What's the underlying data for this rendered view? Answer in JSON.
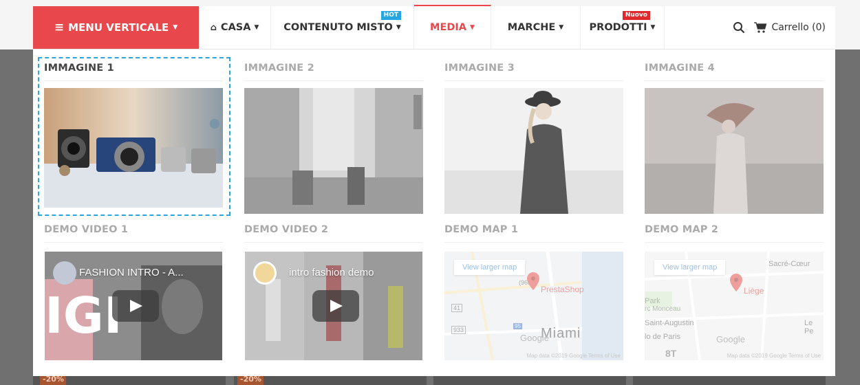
{
  "nav": {
    "vertical_menu": "MENU VERTICALE",
    "items": [
      {
        "label": "CASA"
      },
      {
        "label": "CONTENUTO MISTO",
        "badge": "HOT"
      },
      {
        "label": "MEDIA"
      },
      {
        "label": "MARCHE"
      },
      {
        "label": "PRODOTTI",
        "badge": "Nuovo"
      }
    ],
    "cart": "Carrello (0)",
    "active_color": "#e8474c",
    "vertical_menu_color": "#e8474c",
    "hot_badge_color": "#27a6e0",
    "new_badge_color": "#e0292f"
  },
  "media": {
    "images": [
      {
        "title": "IMMAGINE 1"
      },
      {
        "title": "IMMAGINE 2"
      },
      {
        "title": "IMMAGINE 3"
      },
      {
        "title": "IMMAGINE 4"
      }
    ],
    "videos": [
      {
        "title": "DEMO VIDEO 1",
        "video_title": "FASHION INTRO - A..."
      },
      {
        "title": "DEMO VIDEO 2",
        "video_title": "intro fashion demo"
      }
    ],
    "maps": [
      {
        "title": "DEMO MAP 1",
        "button": "View larger map",
        "place": "PrestaShop",
        "city": "Miami",
        "num1": "(968)",
        "num2": "41",
        "num3": "933",
        "num4": "95",
        "brand": "Google",
        "footer": "Map data ©2019 Google   Terms of Use"
      },
      {
        "title": "DEMO MAP 2",
        "button": "View larger map",
        "place": "Liège",
        "l1": "Sacré-Cœur",
        "l2": "Park",
        "l3": "rc Monceau",
        "l4": "Saint-Augustin",
        "l5": "lo de Paris",
        "l6": "Le Pe",
        "l7": "8T",
        "brand": "Google",
        "footer": "Map data ©2019 Google   Terms of Use"
      }
    ],
    "selection_color": "#2aa4dd"
  },
  "background": {
    "badges": [
      "-20%",
      "-20%"
    ]
  }
}
